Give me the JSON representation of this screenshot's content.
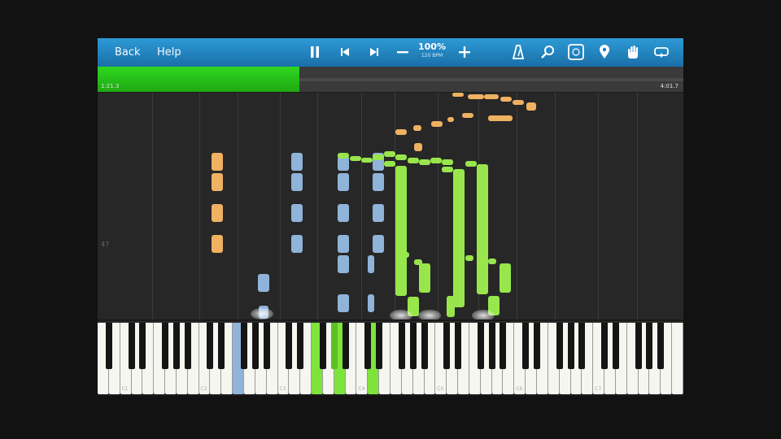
{
  "toolbar": {
    "back_label": "Back",
    "help_label": "Help",
    "zoom_percent": "100%",
    "zoom_bpm": "120 BPM",
    "buttons": [
      "pause-icon",
      "skip-back-icon",
      "skip-forward-icon",
      "minus-icon",
      "plus-icon",
      "metronome-icon",
      "search-icon",
      "keyboard-icon",
      "location-pin-icon",
      "hand-icon",
      "loop-icon"
    ]
  },
  "progress": {
    "elapsed": "1:21.3",
    "total": "4:01.7",
    "fraction": 0.345
  },
  "roll": {
    "marker_label": "47",
    "colors": {
      "orange": "#efb162",
      "blue": "#8fb3d9",
      "green": "#98e64c"
    }
  },
  "keyboard": {
    "white_key_count": 52,
    "c_labels": [
      "C1",
      "C2",
      "C3",
      "C4",
      "C5",
      "C6",
      "C7"
    ],
    "lit_green": [
      "C4-area",
      "E4-area",
      "A4-area"
    ],
    "lit_blue": [
      "E3-area"
    ]
  }
}
